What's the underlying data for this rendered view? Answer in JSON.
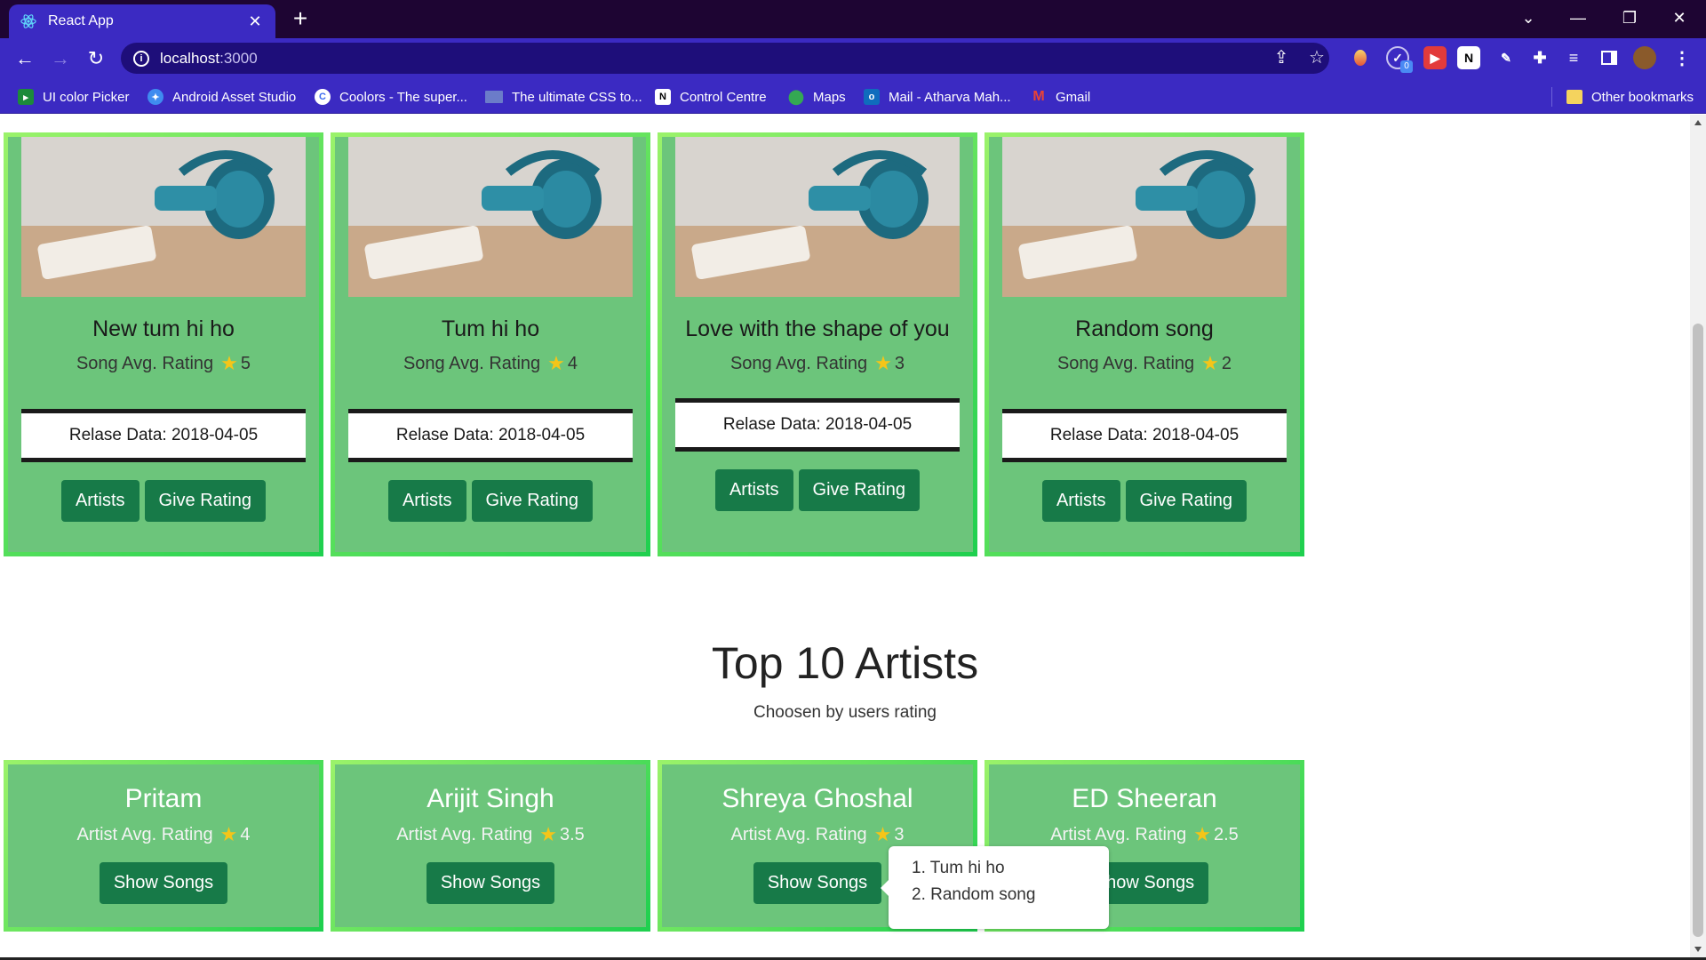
{
  "browser": {
    "tab_title": "React App",
    "url_host": "localhost",
    "url_port": ":3000",
    "bookmarks": [
      {
        "label": "UI color Picker",
        "icon": "android-studio-icon"
      },
      {
        "label": "Android Asset Studio",
        "icon": "asset-studio-icon"
      },
      {
        "label": "Coolors - The super...",
        "icon": "coolors-icon"
      },
      {
        "label": "The ultimate CSS to...",
        "icon": "css-tools-icon"
      },
      {
        "label": "Control Centre",
        "icon": "notion-icon"
      },
      {
        "label": "Maps",
        "icon": "maps-pin-icon"
      },
      {
        "label": "Mail - Atharva Mah...",
        "icon": "outlook-icon"
      },
      {
        "label": "Gmail",
        "icon": "gmail-icon"
      }
    ],
    "other_bookmarks": "Other bookmarks",
    "extension_badge": "0"
  },
  "songs": [
    {
      "title": "New tum hi ho",
      "rating_label": "Song Avg. Rating",
      "rating": "5",
      "release": "Relase Data: 2018-04-05",
      "artists_btn": "Artists",
      "rate_btn": "Give Rating"
    },
    {
      "title": "Tum hi ho",
      "rating_label": "Song Avg. Rating",
      "rating": "4",
      "release": "Relase Data: 2018-04-05",
      "artists_btn": "Artists",
      "rate_btn": "Give Rating"
    },
    {
      "title": "Love with the shape of you",
      "rating_label": "Song Avg. Rating",
      "rating": "3",
      "release": "Relase Data: 2018-04-05",
      "artists_btn": "Artists",
      "rate_btn": "Give Rating"
    },
    {
      "title": "Random song",
      "rating_label": "Song Avg. Rating",
      "rating": "2",
      "release": "Relase Data: 2018-04-05",
      "artists_btn": "Artists",
      "rate_btn": "Give Rating"
    }
  ],
  "artists_section": {
    "title": "Top 10 Artists",
    "subtitle": "Choosen by users rating"
  },
  "artists": [
    {
      "name": "Pritam",
      "rating_label": "Artist Avg. Rating",
      "rating": "4",
      "btn": "Show Songs"
    },
    {
      "name": "Arijit Singh",
      "rating_label": "Artist Avg. Rating",
      "rating": "3.5",
      "btn": "Show Songs"
    },
    {
      "name": "Shreya Ghoshal",
      "rating_label": "Artist Avg. Rating",
      "rating": "3",
      "btn": "Show Songs"
    },
    {
      "name": "ED Sheeran",
      "rating_label": "Artist Avg. Rating",
      "rating": "2.5",
      "btn": "Show Songs"
    }
  ],
  "popover": {
    "items": [
      "1. Tum hi ho",
      "2. Random song"
    ]
  },
  "colors": {
    "card_bg": "#6cc57b",
    "card_border": "#22d150",
    "button": "#177a48",
    "star": "#f5c518",
    "browser_accent": "#3b2ac2"
  }
}
